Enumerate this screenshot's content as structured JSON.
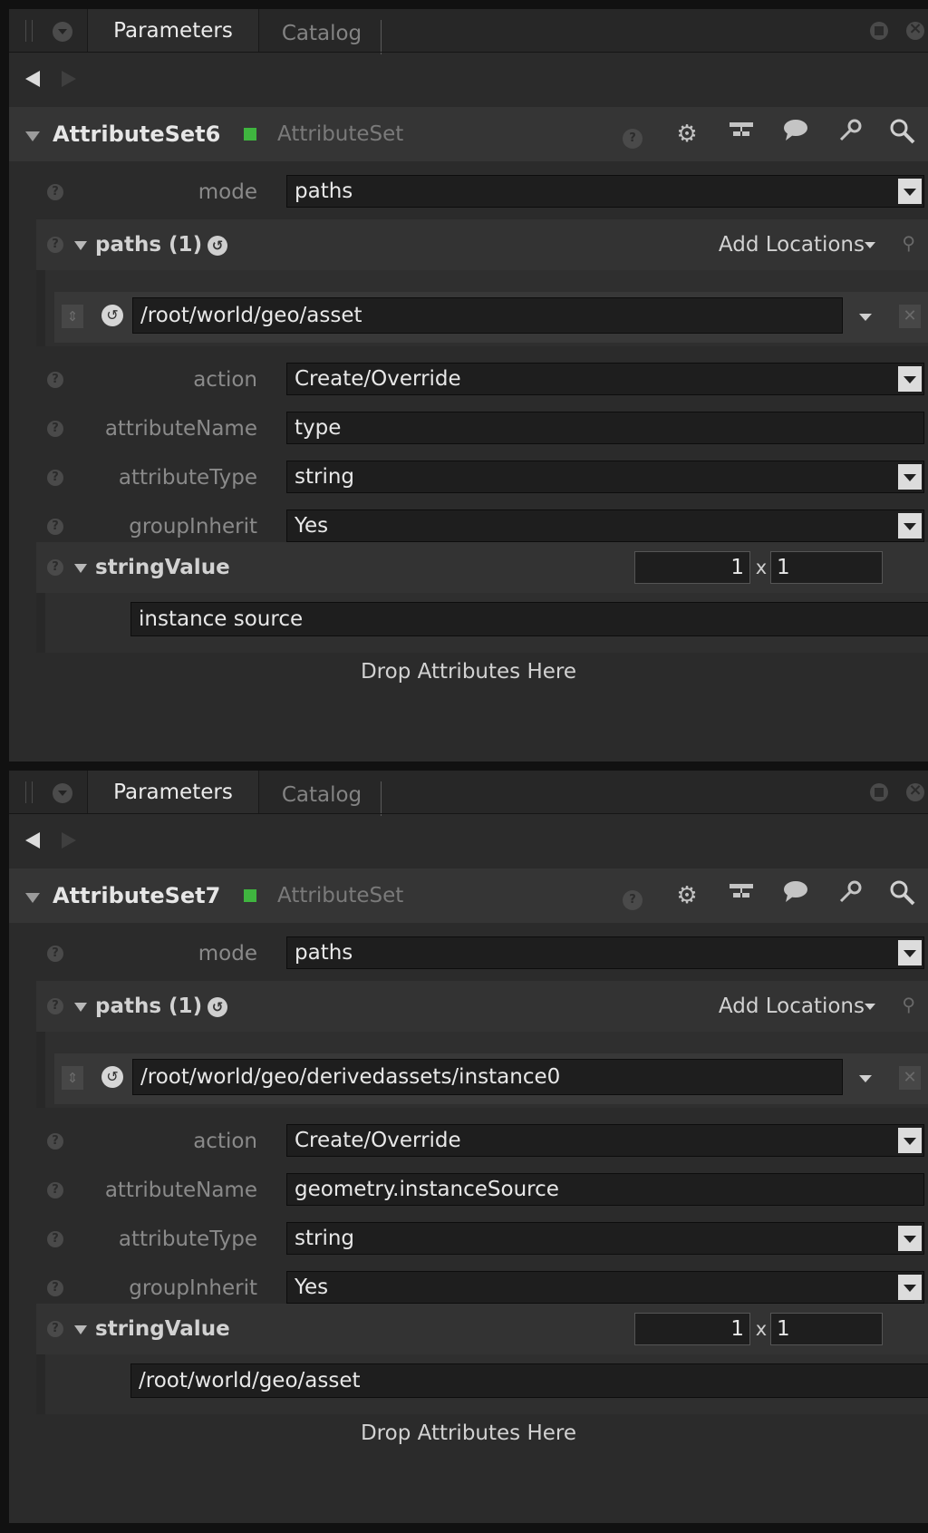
{
  "panels": [
    {
      "tabs": {
        "active": "Parameters",
        "inactive": "Catalog"
      },
      "node": {
        "name": "AttributeSet6",
        "type": "AttributeSet"
      },
      "mode": {
        "label": "mode",
        "value": "paths"
      },
      "paths": {
        "title": "paths (1)",
        "add_locations": "Add Locations",
        "path": "/root/world/geo/asset"
      },
      "action": {
        "label": "action",
        "value": "Create/Override"
      },
      "attributeName": {
        "label": "attributeName",
        "value": "type"
      },
      "attributeType": {
        "label": "attributeType",
        "value": "string"
      },
      "groupInherit": {
        "label": "groupInherit",
        "value": "Yes"
      },
      "stringValue": {
        "title": "stringValue",
        "rows": "1",
        "x": "x",
        "cols": "1",
        "value": "instance source"
      },
      "drop_text": "Drop Attributes Here"
    },
    {
      "tabs": {
        "active": "Parameters",
        "inactive": "Catalog"
      },
      "node": {
        "name": "AttributeSet7",
        "type": "AttributeSet"
      },
      "mode": {
        "label": "mode",
        "value": "paths"
      },
      "paths": {
        "title": "paths (1)",
        "add_locations": "Add Locations",
        "path": "/root/world/geo/derivedassets/instance0"
      },
      "action": {
        "label": "action",
        "value": "Create/Override"
      },
      "attributeName": {
        "label": "attributeName",
        "value": "geometry.instanceSource"
      },
      "attributeType": {
        "label": "attributeType",
        "value": "string"
      },
      "groupInherit": {
        "label": "groupInherit",
        "value": "Yes"
      },
      "stringValue": {
        "title": "stringValue",
        "rows": "1",
        "x": "x",
        "cols": "1",
        "value": "/root/world/geo/asset"
      },
      "drop_text": "Drop Attributes Here"
    }
  ],
  "icons": {
    "help": "help-icon",
    "gear": "gear-icon",
    "graph": "node-graph-icon",
    "bubble": "speech-bubble-icon",
    "wrench": "wrench-icon",
    "search": "search-icon",
    "reset": "reset-icon",
    "drag": "drag-handle-icon",
    "delete": "delete-icon"
  },
  "colors": {
    "node_status": "#3fb53f",
    "background": "#2b2b2b",
    "field": "#1e1e1e"
  }
}
